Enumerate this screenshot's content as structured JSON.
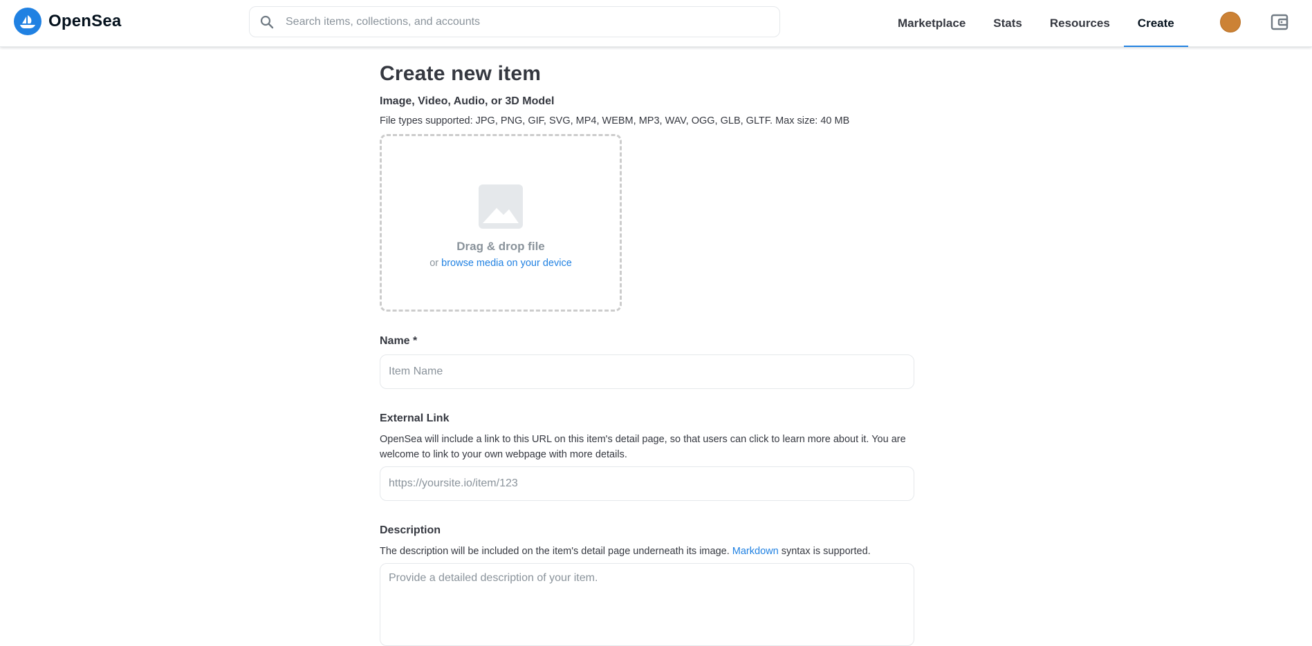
{
  "header": {
    "logo_text": "OpenSea",
    "search_placeholder": "Search items, collections, and accounts",
    "nav": [
      {
        "label": "Marketplace"
      },
      {
        "label": "Stats"
      },
      {
        "label": "Resources"
      },
      {
        "label": "Create",
        "active": true
      }
    ],
    "icons": [
      "opensea-logo-icon",
      "search-icon",
      "avatar",
      "wallet-icon"
    ]
  },
  "main": {
    "title": "Create new item",
    "media": {
      "label": "Image, Video, Audio, or 3D Model",
      "caption": "File types supported: JPG, PNG, GIF, SVG, MP4, WEBM, MP3, WAV, OGG, GLB, GLTF. Max size: 40 MB",
      "drop_title": "Drag & drop file",
      "drop_or": "or",
      "drop_link": "browse media on your device"
    },
    "name": {
      "label": "Name *",
      "placeholder": "Item Name",
      "value": ""
    },
    "external_link": {
      "label": "External Link",
      "caption": "OpenSea will include a link to this URL on this item's detail page, so that users can click to learn more about it. You are welcome to link to your own webpage with more details.",
      "placeholder": "https://yoursite.io/item/123",
      "value": ""
    },
    "description": {
      "label": "Description",
      "caption_before": "The description will be included on the item's detail page underneath its image.",
      "caption_link": "Markdown",
      "caption_after": "syntax is supported.",
      "placeholder": "Provide a detailed description of your item.",
      "value": ""
    }
  },
  "colors": {
    "accent": "#2081e2",
    "text": "#353840",
    "muted": "#8a939b",
    "border": "#e5e8eb",
    "avatar": "#cc8235"
  }
}
